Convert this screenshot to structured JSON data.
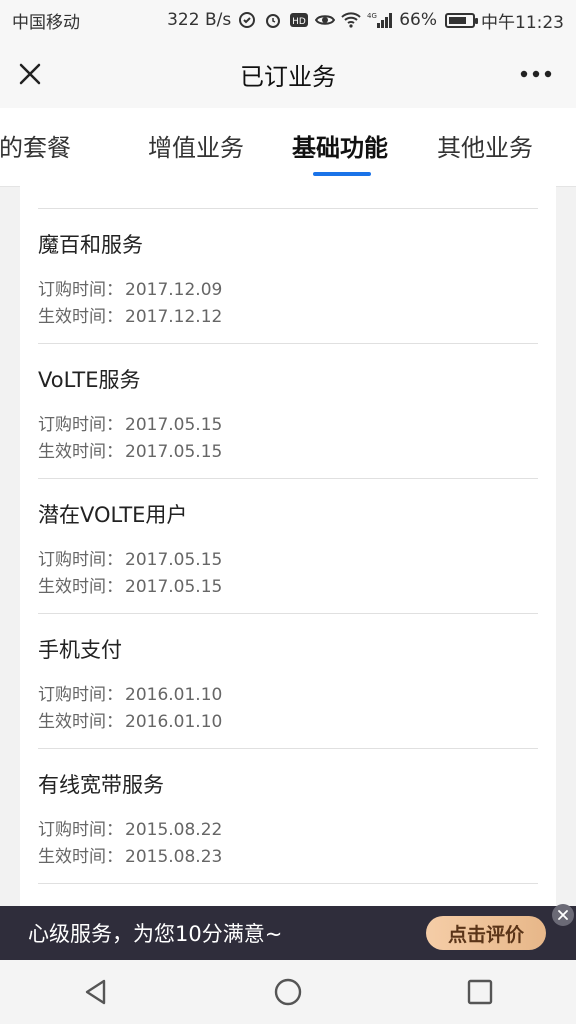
{
  "status_bar": {
    "carrier": "中国移动",
    "speed": "322 B/s",
    "network": "4G",
    "battery": "66%",
    "time": "中午11:23"
  },
  "header": {
    "title": "已订业务"
  },
  "tabs": [
    {
      "label": "我的套餐"
    },
    {
      "label": "增值业务"
    },
    {
      "label": "基础功能",
      "active": true
    },
    {
      "label": "其他业务"
    }
  ],
  "list": {
    "order_label": "订购时间：",
    "effective_label": "生效时间：",
    "items": [
      {
        "name": "魔百和服务",
        "order_date": "2017.12.09",
        "effective_date": "2017.12.12"
      },
      {
        "name": "VoLTE服务",
        "order_date": "2017.05.15",
        "effective_date": "2017.05.15"
      },
      {
        "name": "潜在VOLTE用户",
        "order_date": "2017.05.15",
        "effective_date": "2017.05.15"
      },
      {
        "name": "手机支付",
        "order_date": "2016.01.10",
        "effective_date": "2016.01.10"
      },
      {
        "name": "有线宽带服务",
        "order_date": "2015.08.22",
        "effective_date": "2015.08.23"
      }
    ]
  },
  "banner": {
    "text": "心级服务，为您10分满意~",
    "button_label": "点击评价"
  },
  "icons": {
    "close": "close-icon",
    "more": "more-icon",
    "back": "back-icon",
    "home": "home-icon",
    "recents": "recents-icon"
  },
  "colors": {
    "accent": "#1a73e8",
    "banner_bg": "#2f2d3b",
    "banner_button": "#f5cda7"
  }
}
